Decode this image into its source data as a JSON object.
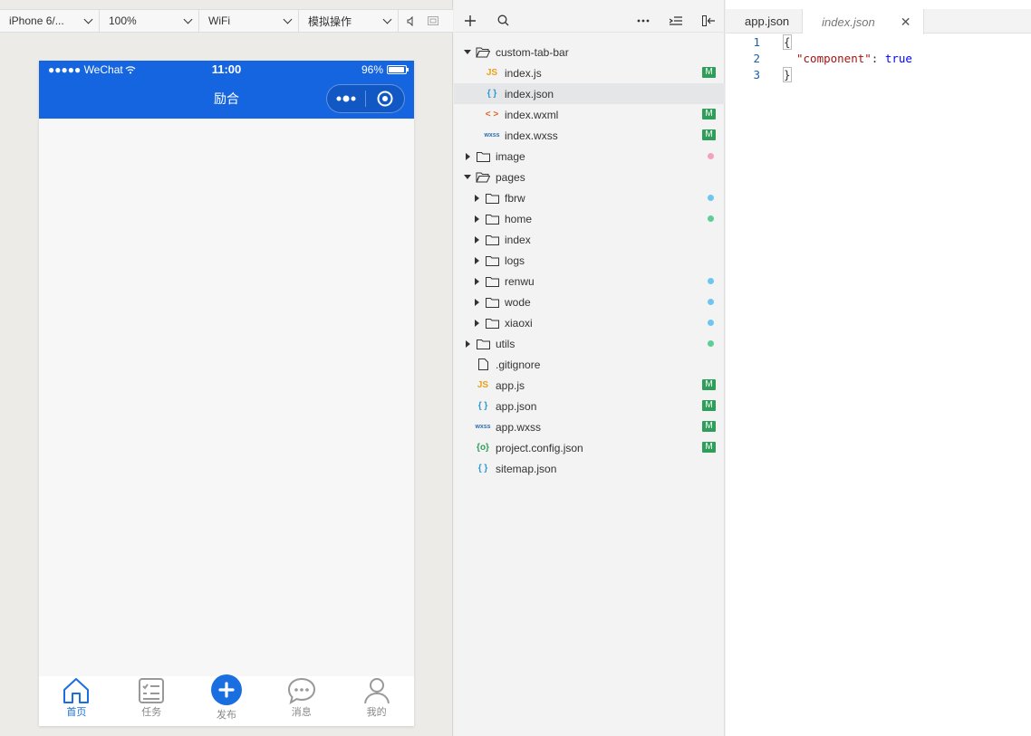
{
  "simulator": {
    "device": "iPhone 6/...",
    "zoom": "100%",
    "network": "WiFi",
    "mode": "模拟操作"
  },
  "phone": {
    "carrier": "●●●●● WeChat",
    "time": "11:00",
    "battery_label": "96%",
    "battery_level": 0.96,
    "nav_title": "励合",
    "header_color": "#1565e0",
    "tabs": [
      {
        "label": "首页",
        "icon": "home-icon",
        "active": true
      },
      {
        "label": "任务",
        "icon": "task-list-icon",
        "active": false
      },
      {
        "label": "发布",
        "icon": "plus-circle-icon",
        "active": false
      },
      {
        "label": "消息",
        "icon": "chat-bubble-icon",
        "active": false
      },
      {
        "label": "我的",
        "icon": "user-icon",
        "active": false
      }
    ]
  },
  "explorer": {
    "tree": [
      {
        "label": "custom-tab-bar",
        "type": "folder",
        "open": true
      },
      {
        "label": "index.js",
        "type": "js",
        "badge": "M"
      },
      {
        "label": "index.json",
        "type": "json",
        "selected": true
      },
      {
        "label": "index.wxml",
        "type": "wxml",
        "badge": "M"
      },
      {
        "label": "index.wxss",
        "type": "wxss",
        "badge": "M"
      },
      {
        "label": "image",
        "type": "folder",
        "dot": "#f4a0c0"
      },
      {
        "label": "pages",
        "type": "folder",
        "open": true
      },
      {
        "label": "fbrw",
        "type": "folder",
        "dot": "#6ec6f0"
      },
      {
        "label": "home",
        "type": "folder",
        "dot": "#5ccf95"
      },
      {
        "label": "index",
        "type": "folder"
      },
      {
        "label": "logs",
        "type": "folder"
      },
      {
        "label": "renwu",
        "type": "folder",
        "dot": "#6ec6f0"
      },
      {
        "label": "wode",
        "type": "folder",
        "dot": "#6ec6f0"
      },
      {
        "label": "xiaoxi",
        "type": "folder",
        "dot": "#6ec6f0"
      },
      {
        "label": "utils",
        "type": "folder",
        "dot": "#5ccf95"
      },
      {
        "label": ".gitignore",
        "type": "file"
      },
      {
        "label": "app.js",
        "type": "js",
        "badge": "M"
      },
      {
        "label": "app.json",
        "type": "json",
        "badge": "M"
      },
      {
        "label": "app.wxss",
        "type": "wxss",
        "badge": "M"
      },
      {
        "label": "project.config.json",
        "type": "config",
        "badge": "M"
      },
      {
        "label": "sitemap.json",
        "type": "json"
      }
    ]
  },
  "editor": {
    "tabs": [
      {
        "label": "app.json",
        "active": false
      },
      {
        "label": "index.json",
        "active": true,
        "close": "✕"
      }
    ],
    "lines": [
      {
        "num": "1",
        "text": "{"
      },
      {
        "num": "2",
        "key": "\"component\"",
        "sep": ": ",
        "value": "true"
      },
      {
        "num": "3",
        "text": "}"
      }
    ]
  },
  "icons": {
    "js": "JS",
    "json": "{ }",
    "wxml": "< >",
    "wxss": "wxss",
    "config": "{o}"
  },
  "colors": {
    "accent": "#1a6fe0",
    "badge_green": "#2e9e5a"
  }
}
